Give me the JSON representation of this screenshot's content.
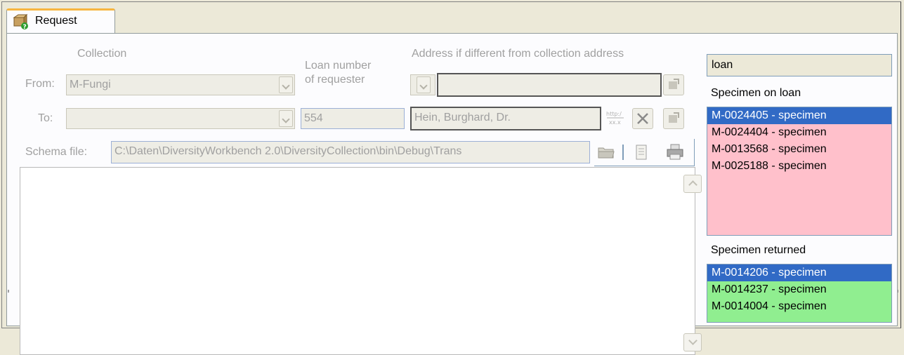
{
  "tab": {
    "label": "Request",
    "icon": "package-request-icon"
  },
  "form": {
    "collection_label": "Collection",
    "from_label": "From:",
    "from_value": "M-Fungi",
    "to_label": "To:",
    "to_value": "",
    "loan_number_label_line1": "Loan number",
    "loan_number_label_line2": "of requester",
    "loan_number_value": "554",
    "address_label": "Address if different from collection address",
    "address_value": "",
    "person_value": "Hein, Burghard, Dr.",
    "schema_label": "Schema file:",
    "schema_value": "C:\\Daten\\DiversityWorkbench 2.0\\DiversityCollection\\bin\\Debug\\Trans"
  },
  "right_panel": {
    "title_value": "loan",
    "on_loan_label": "Specimen on loan",
    "on_loan_items": [
      "M-0024405 - specimen",
      "M-0024404 - specimen",
      "M-0013568 - specimen",
      "M-0025188 - specimen"
    ],
    "returned_label": "Specimen returned",
    "returned_items": [
      "M-0014206 - specimen",
      "M-0014237 - specimen",
      "M-0014004 - specimen"
    ]
  },
  "colors": {
    "on_loan_bg": "#ffc0cb",
    "returned_bg": "#90ee90",
    "selection": "#316ac5",
    "tab_accent": "#f7b53f"
  }
}
